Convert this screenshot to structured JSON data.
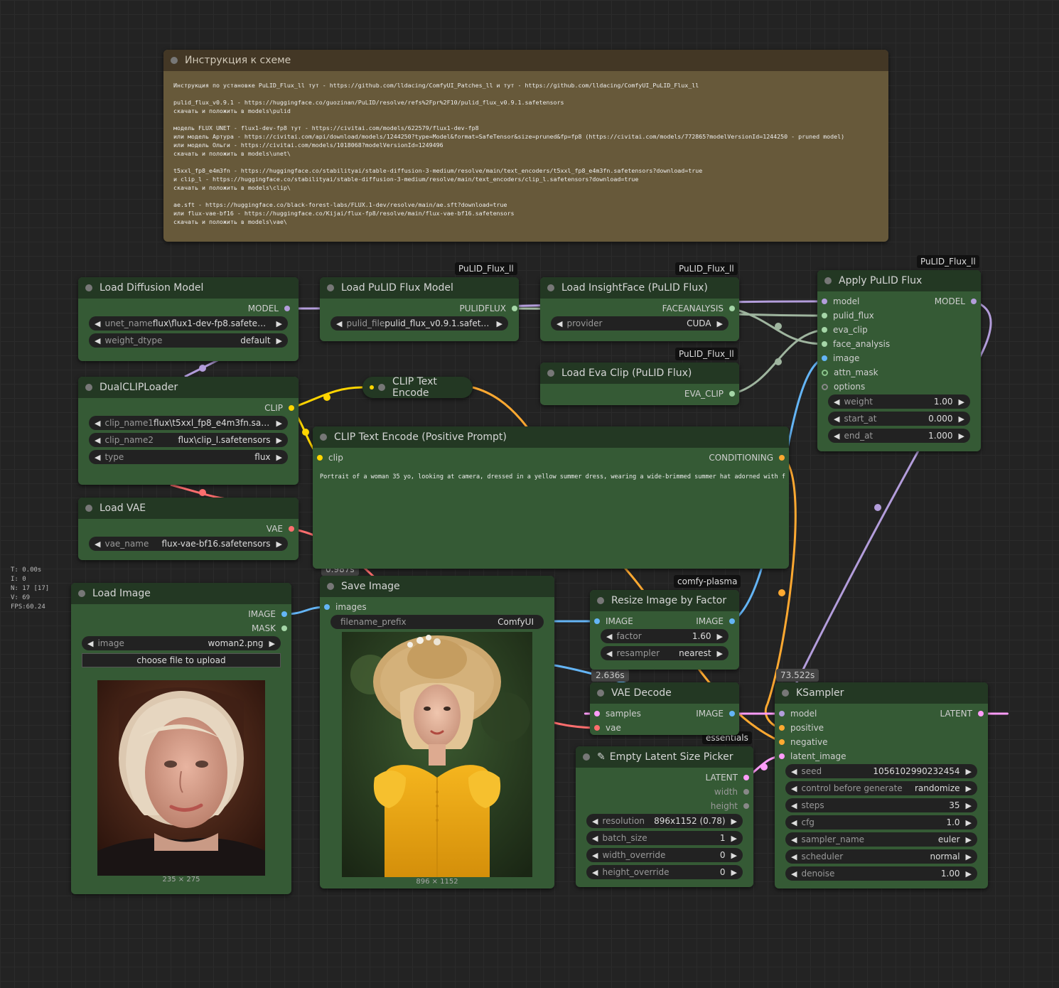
{
  "stats": {
    "t": "T: 0.00s",
    "i": "I: 0",
    "n": "N: 17 [17]",
    "v": "V: 69",
    "fps": "FPS:60.24"
  },
  "note": {
    "title": "Инструкция к схеме",
    "text": "Инструкция по установке PuLID_Flux_ll тут - https://github.com/lldacing/ComfyUI_Patches_ll и тут - https://github.com/lldacing/ComfyUI_PuLID_Flux_ll\n\npulid_flux_v0.9.1 - https://huggingface.co/guozinan/PuLID/resolve/refs%2Fpr%2F10/pulid_flux_v0.9.1.safetensors\nскачать и положить в models\\pulid\n\nмодель FLUX UNET - flux1-dev-fp8 тут - https://civitai.com/models/622579/flux1-dev-fp8\nили модель Артура - https://civitai.com/api/download/models/1244250?type=Model&format=SafeTensor&size=pruned&fp=fp8 (https://civitai.com/models/772865?modelVersionId=1244250 - pruned model)\nили модель Ольги - https://civitai.com/models/1018068?modelVersionId=1249496\nскачать и положить в models\\unet\\\n\nt5xxl_fp8_e4m3fn - https://huggingface.co/stabilityai/stable-diffusion-3-medium/resolve/main/text_encoders/t5xxl_fp8_e4m3fn.safetensors?download=true\nи clip_l - https://huggingface.co/stabilityai/stable-diffusion-3-medium/resolve/main/text_encoders/clip_l.safetensors?download=true\nскачать и положить в models\\clip\\\n\nae.sft - https://huggingface.co/black-forest-labs/FLUX.1-dev/resolve/main/ae.sft?download=true\nили flux-vae-bf16 - https://huggingface.co/Kijai/flux-fp8/resolve/main/flux-vae-bf16.safetensors\nскачать и положить в models\\vae\\"
  },
  "badges": {
    "pulid1": "PuLID_Flux_ll",
    "pulid2": "PuLID_Flux_ll",
    "pulid3": "PuLID_Flux_ll",
    "pulid4": "PuLID_Flux_ll",
    "plasma": "comfy-plasma",
    "essentials": "essentials"
  },
  "times": {
    "save": "0.987s",
    "vae": "2.636s",
    "ksampler": "73.522s"
  },
  "load_diffusion": {
    "title": "Load Diffusion Model",
    "out": "MODEL",
    "unet_label": "unet_name",
    "unet_value": "flux\\flux1-dev-fp8.safetens...",
    "dtype_label": "weight_dtype",
    "dtype_value": "default"
  },
  "load_pulid": {
    "title": "Load PuLID Flux Model",
    "out": "PULIDFLUX",
    "file_label": "pulid_file",
    "file_value": "pulid_flux_v0.9.1.safete..."
  },
  "load_insight": {
    "title": "Load InsightFace (PuLID Flux)",
    "out": "FACEANALYSIS",
    "prov_label": "provider",
    "prov_value": "CUDA"
  },
  "load_eva": {
    "title": "Load Eva Clip (PuLID Flux)",
    "out": "EVA_CLIP"
  },
  "apply_pulid": {
    "title": "Apply PuLID Flux",
    "out": "MODEL",
    "inputs": [
      "model",
      "pulid_flux",
      "eva_clip",
      "face_analysis",
      "image",
      "attn_mask",
      "options"
    ],
    "weight_label": "weight",
    "weight_value": "1.00",
    "start_label": "start_at",
    "start_value": "0.000",
    "end_label": "end_at",
    "end_value": "1.000"
  },
  "dual_clip": {
    "title": "DualCLIPLoader",
    "out": "CLIP",
    "c1_label": "clip_name1",
    "c1_value": "flux\\t5xxl_fp8_e4m3fn.saf...",
    "c2_label": "clip_name2",
    "c2_value": "flux\\clip_l.safetensors",
    "type_label": "type",
    "type_value": "flux"
  },
  "clip_text": {
    "title": "CLIP Text Encode"
  },
  "clip_pos": {
    "title": "CLIP Text Encode (Positive Prompt)",
    "in": "clip",
    "out": "CONDITIONING",
    "prompt": "Portrait of a woman 35 yo, looking at camera, dressed in a yellow summer dress, wearing a wide-brimmed summer hat adorned with flowers."
  },
  "load_vae": {
    "title": "Load VAE",
    "out": "VAE",
    "vae_label": "vae_name",
    "vae_value": "flux-vae-bf16.safetensors"
  },
  "load_image": {
    "title": "Load Image",
    "out1": "IMAGE",
    "out2": "MASK",
    "img_label": "image",
    "img_value": "woman2.png",
    "upload": "choose file to upload",
    "size": "235 × 275"
  },
  "save_image": {
    "title": "Save Image",
    "in": "images",
    "prefix_label": "filename_prefix",
    "prefix_value": "ComfyUI",
    "size": "896 × 1152"
  },
  "resize": {
    "title": "Resize Image by Factor",
    "in": "IMAGE",
    "out": "IMAGE",
    "factor_label": "factor",
    "factor_value": "1.60",
    "res_label": "resampler",
    "res_value": "nearest"
  },
  "vae_decode": {
    "title": "VAE Decode",
    "in1": "samples",
    "in2": "vae",
    "out": "IMAGE"
  },
  "latent_picker": {
    "title": "Empty Latent Size Picker",
    "out1": "LATENT",
    "out2": "width",
    "out3": "height",
    "res_label": "resolution",
    "res_value": "896x1152 (0.78)",
    "batch_label": "batch_size",
    "batch_value": "1",
    "w_label": "width_override",
    "w_value": "0",
    "h_label": "height_override",
    "h_value": "0"
  },
  "ksampler": {
    "title": "KSampler",
    "out": "LATENT",
    "inputs": [
      "model",
      "positive",
      "negative",
      "latent_image"
    ],
    "seed_label": "seed",
    "seed_value": "1056102990232454",
    "cbg_label": "control before generate",
    "cbg_value": "randomize",
    "steps_label": "steps",
    "steps_value": "35",
    "cfg_label": "cfg",
    "cfg_value": "1.0",
    "sampler_label": "sampler_name",
    "sampler_value": "euler",
    "sched_label": "scheduler",
    "sched_value": "normal",
    "denoise_label": "denoise",
    "denoise_value": "1.00"
  },
  "colors": {
    "model": "#b39ddb",
    "clip": "#ffd500",
    "vae": "#ff6e6e",
    "image": "#64b5f6",
    "latent": "#ff9cf9",
    "conditioning": "#ffa931",
    "pulid": "#a5d6a7",
    "node_body": "#355a35",
    "node_title": "#233823"
  }
}
